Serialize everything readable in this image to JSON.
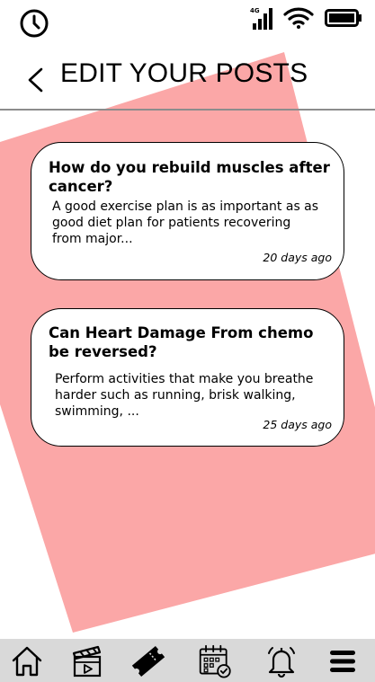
{
  "colors": {
    "accent_shape": "#fba7a7",
    "nav_background": "#d9d9d9",
    "divider": "#8c8c8c"
  },
  "status_bar": {
    "network_label": "4G",
    "icons": [
      "clock-icon",
      "cellular-signal-icon",
      "wifi-icon",
      "battery-icon"
    ]
  },
  "header": {
    "title": "EDIT YOUR POSTS",
    "back_icon": "chevron-left-icon"
  },
  "posts": [
    {
      "title": "How do you rebuild muscles after cancer?",
      "excerpt": "A good exercise plan is as important as as good diet plan for patients recovering from major...",
      "date": "20 days ago"
    },
    {
      "title": "Can Heart Damage From chemo be reversed?",
      "excerpt": "Perform activities that make you breathe harder such as running, brisk walking, swimming, ...",
      "date": "25 days ago"
    }
  ],
  "bottom_nav": {
    "items": [
      "home-icon",
      "video-clapperboard-icon",
      "ticket-icon",
      "calendar-check-icon",
      "bell-icon",
      "menu-icon"
    ],
    "active": "ticket-icon"
  }
}
